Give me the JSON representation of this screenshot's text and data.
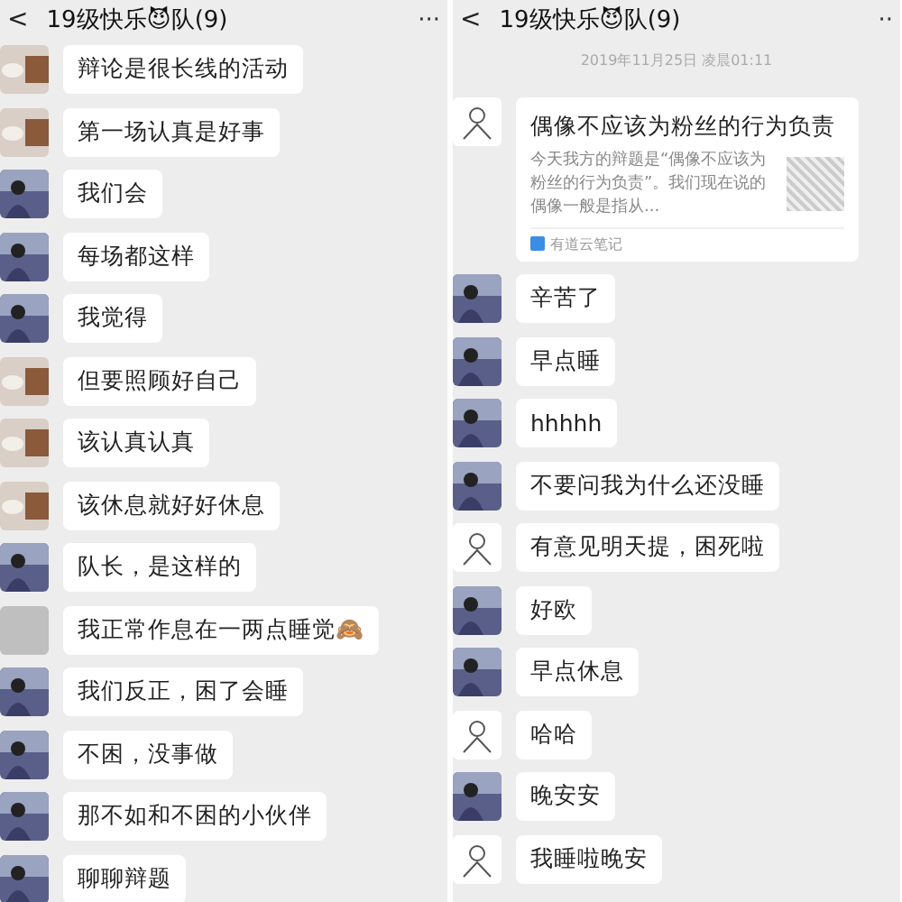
{
  "panels": [
    {
      "header": {
        "back": "<",
        "title": "19级快乐😈队(9)",
        "more": "···"
      },
      "messages": [
        {
          "kind": "photo",
          "text": "辩论是很长线的活动"
        },
        {
          "kind": "photo",
          "text": "第一场认真是好事"
        },
        {
          "kind": "man",
          "text": "我们会"
        },
        {
          "kind": "man",
          "text": "每场都这样"
        },
        {
          "kind": "man",
          "text": "我觉得"
        },
        {
          "kind": "photo",
          "text": "但要照顾好自己"
        },
        {
          "kind": "photo",
          "text": "该认真认真"
        },
        {
          "kind": "photo",
          "text": "该休息就好好休息"
        },
        {
          "kind": "man",
          "text": "队长，是这样的"
        },
        {
          "kind": "gray",
          "text": "我正常作息在一两点睡觉🙈"
        },
        {
          "kind": "man",
          "text": "我们反正，困了会睡"
        },
        {
          "kind": "man",
          "text": "不困，没事做"
        },
        {
          "kind": "man",
          "text": "那不如和不困的小伙伴"
        },
        {
          "kind": "man",
          "text": "聊聊辩题"
        }
      ]
    },
    {
      "header": {
        "back": "<",
        "title": "19级快乐😈队(9)",
        "more": "··"
      },
      "timestamp": "2019年11月25日 凌晨01:11",
      "card": {
        "kind": "sketch",
        "title": "偶像不应该为粉丝的行为负责",
        "description": "今天我方的辩题是“偶像不应该为粉丝的行为负责”。我们现在说的偶像一般是指从...",
        "source": "有道云笔记"
      },
      "messages": [
        {
          "kind": "man",
          "text": "辛苦了"
        },
        {
          "kind": "man",
          "text": "早点睡"
        },
        {
          "kind": "man",
          "text": "hhhhh"
        },
        {
          "kind": "man",
          "text": "不要问我为什么还没睡"
        },
        {
          "kind": "sketch",
          "text": "有意见明天提，困死啦"
        },
        {
          "kind": "man",
          "text": "好欧"
        },
        {
          "kind": "man",
          "text": "早点休息"
        },
        {
          "kind": "sketch",
          "text": "哈哈"
        },
        {
          "kind": "man",
          "text": "晚安安"
        },
        {
          "kind": "sketch",
          "text": "我睡啦晚安"
        }
      ]
    }
  ]
}
